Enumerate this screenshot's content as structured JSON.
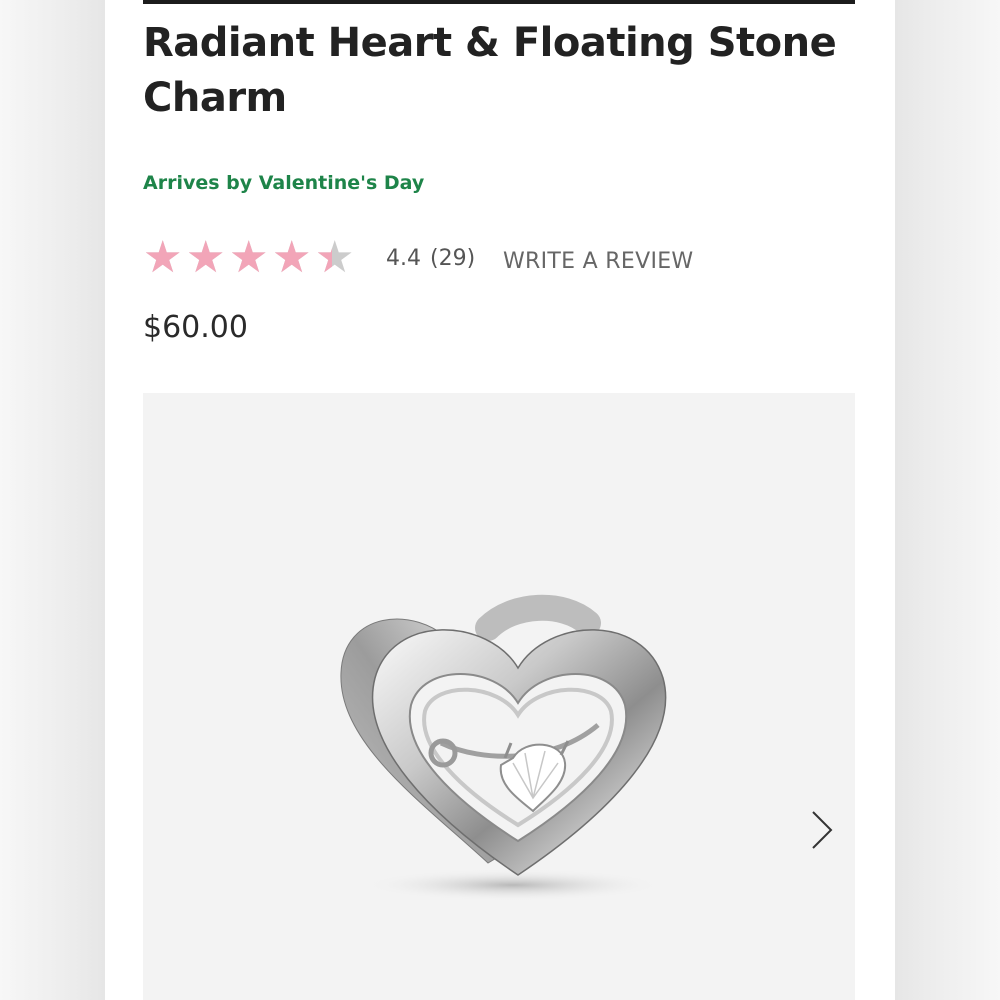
{
  "product": {
    "title": "Radiant Heart & Floating Stone Charm",
    "delivery_note": "Arrives by Valentine's Day",
    "rating": {
      "value": "4.4",
      "count": "(29)",
      "stars_filled": 4.4,
      "stars_max": 5,
      "write_review_label": "WRITE A REVIEW"
    },
    "price": "$60.00"
  },
  "gallery": {
    "image_icon": "heart-charm-image",
    "next_icon": "chevron-right-icon"
  },
  "colors": {
    "delivery_text": "#1e8449",
    "star_filled": "#f2a5b8",
    "star_empty": "#cccccc",
    "title_text": "#222222"
  }
}
